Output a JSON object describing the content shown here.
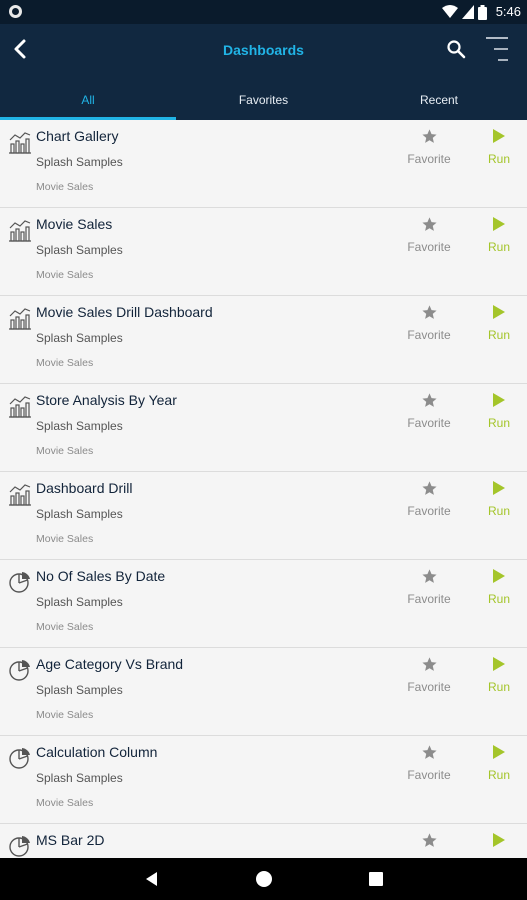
{
  "status_bar": {
    "time": "5:46"
  },
  "header": {
    "title": "Dashboards",
    "tabs": [
      {
        "label": "All",
        "active": true
      },
      {
        "label": "Favorites",
        "active": false
      },
      {
        "label": "Recent",
        "active": false
      }
    ]
  },
  "list": {
    "items": [
      {
        "title": "Chart Gallery",
        "group": "Splash Samples",
        "category": "Movie Sales",
        "icon": "bar-chart-icon",
        "favorite_label": "Favorite",
        "run_label": "Run"
      },
      {
        "title": "Movie Sales",
        "group": "Splash Samples",
        "category": "Movie Sales",
        "icon": "bar-chart-icon",
        "favorite_label": "Favorite",
        "run_label": "Run"
      },
      {
        "title": "Movie Sales Drill Dashboard",
        "group": "Splash Samples",
        "category": "Movie Sales",
        "icon": "bar-chart-icon",
        "favorite_label": "Favorite",
        "run_label": "Run"
      },
      {
        "title": "Store Analysis By Year",
        "group": "Splash Samples",
        "category": "Movie Sales",
        "icon": "bar-chart-icon",
        "favorite_label": "Favorite",
        "run_label": "Run"
      },
      {
        "title": "Dashboard Drill",
        "group": "Splash Samples",
        "category": "Movie Sales",
        "icon": "bar-chart-icon",
        "favorite_label": "Favorite",
        "run_label": "Run"
      },
      {
        "title": "No Of Sales By Date",
        "group": "Splash Samples",
        "category": "Movie Sales",
        "icon": "pie-chart-icon",
        "favorite_label": "Favorite",
        "run_label": "Run"
      },
      {
        "title": "Age Category Vs Brand",
        "group": "Splash Samples",
        "category": "Movie Sales",
        "icon": "pie-chart-icon",
        "favorite_label": "Favorite",
        "run_label": "Run"
      },
      {
        "title": "Calculation Column",
        "group": "Splash Samples",
        "category": "Movie Sales",
        "icon": "pie-chart-icon",
        "favorite_label": "Favorite",
        "run_label": "Run"
      },
      {
        "title": "MS Bar 2D",
        "group": "",
        "category": "",
        "icon": "pie-chart-icon",
        "favorite_label": "",
        "run_label": ""
      }
    ]
  },
  "colors": {
    "accent": "#21b4e6",
    "header_bg": "#112840",
    "run_green": "#a4c52a",
    "star_gray": "#8c8c8c"
  }
}
